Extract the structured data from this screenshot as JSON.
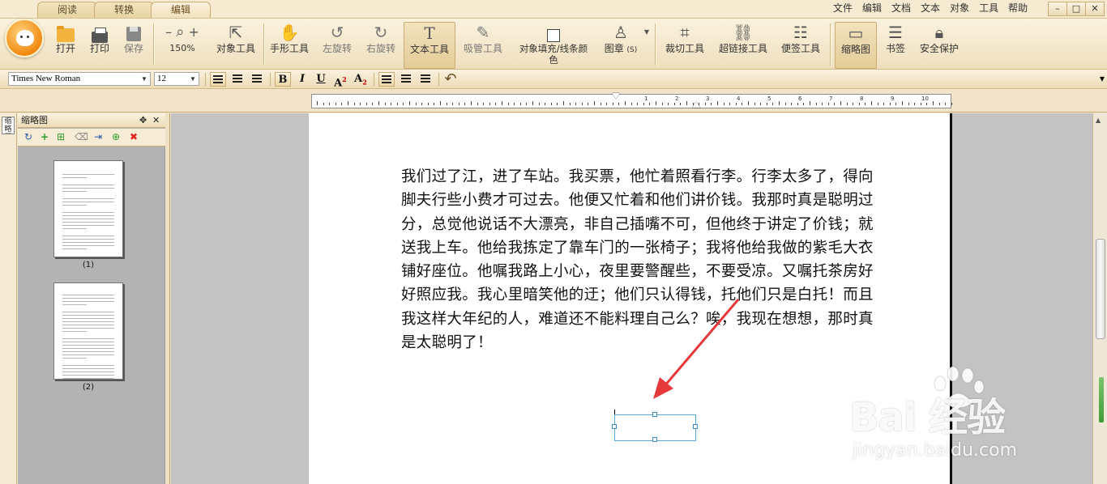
{
  "tabs": [
    {
      "label": "阅读",
      "active": false
    },
    {
      "label": "转换",
      "active": false
    },
    {
      "label": "编辑",
      "active": true
    }
  ],
  "menu": [
    "文件",
    "编辑",
    "文档",
    "文本",
    "对象",
    "工具",
    "帮助"
  ],
  "window_controls": {
    "minimize": "–",
    "maximize": "□",
    "close": "✕"
  },
  "ribbon": {
    "open": "打开",
    "print": "打印",
    "save": "保存",
    "zoom_minus": "–",
    "zoom_plus": "+",
    "zoom_level": "150%",
    "object_tool": "对象工具",
    "hand_tool": "手形工具",
    "rotate_left": "左旋转",
    "rotate_right": "右旋转",
    "text_tool": "文本工具",
    "eyedropper_tool": "吸管工具",
    "object_fill_line1": "对象填充/线条颜",
    "object_fill_line2": "色",
    "stamp": "图章",
    "stamp_shortcut": "(S)",
    "crop_tool": "裁切工具",
    "hyperlink_tool": "超链接工具",
    "note_tool": "便签工具",
    "thumbnail": "缩略图",
    "bookmark": "书签",
    "security": "安全保护"
  },
  "format": {
    "font": "Times New Roman",
    "size": "12",
    "bold": "B",
    "italic": "I",
    "underline": "U",
    "superscript": "A",
    "superscript_mark": "2",
    "subscript": "A",
    "subscript_mark": "2"
  },
  "ruler_numbers": [
    "1",
    "2",
    "3",
    "4",
    "5",
    "6",
    "7",
    "8",
    "9",
    "10"
  ],
  "side_tab": "缩略图",
  "thumbnail_panel": {
    "title": "缩略图",
    "pin": "✥",
    "close": "✕",
    "pages": [
      {
        "label": "(1)"
      },
      {
        "label": "(2)"
      }
    ]
  },
  "document": {
    "lines": [
      "我们过了江，进了车站。我买票，他忙着照看行李。行李太多了，得向",
      "脚夫行些小费才可过去。他便又忙着和他们讲价钱。我那时真是聪明过",
      "分，总觉他说话不大漂亮，非自己插嘴不可，但他终于讲定了价钱；就",
      "送我上车。他给我拣定了靠车门的一张椅子；我将他给我做的紫毛大衣",
      "铺好座位。他嘱我路上小心，夜里要警醒些，不要受凉。又嘱托茶房好",
      "好照应我。我心里暗笑他的迂；他们只认得钱，托他们只是白托！而且",
      "我这样大年纪的人，难道还不能料理自己么？唉，我现在想想，那时真",
      "是太聪明了！"
    ]
  },
  "watermark": {
    "brand": "Bai  经验",
    "url": "jingyan.baidu.com"
  },
  "colors": {
    "accent": "#e88a1a",
    "arrow": "#e5383b",
    "textbox_border": "#5aa9d9"
  }
}
